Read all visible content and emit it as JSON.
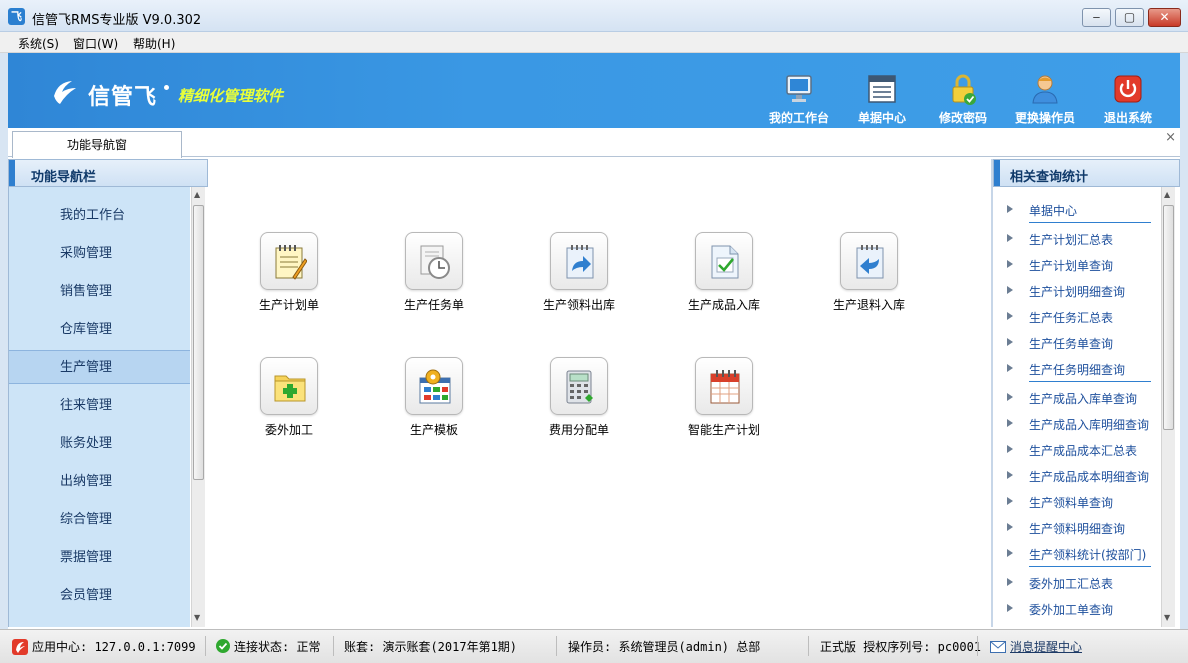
{
  "window": {
    "title": "信管飞RMS专业版 V9.0.302",
    "logo_glyph": "飞",
    "minimize": "‒",
    "restore": "▢",
    "close": "✕"
  },
  "menu": [
    "系统(S)",
    "窗口(W)",
    "帮助(H)"
  ],
  "banner": {
    "brand": "信管飞",
    "slogan": "精细化管理软件",
    "accent_color": "#e8ff3a",
    "tools": [
      {
        "label": "我的工作台",
        "icon": "monitor-icon"
      },
      {
        "label": "单据中心",
        "icon": "document-list-icon"
      },
      {
        "label": "修改密码",
        "icon": "lock-icon"
      },
      {
        "label": "更换操作员",
        "icon": "user-icon"
      },
      {
        "label": "退出系统",
        "icon": "power-icon"
      }
    ]
  },
  "tabs": {
    "active": "功能导航窗",
    "close_glyph": "×"
  },
  "left_panel": {
    "title": "功能导航栏",
    "items": [
      "我的工作台",
      "采购管理",
      "销售管理",
      "仓库管理",
      "生产管理",
      "往来管理",
      "账务处理",
      "出纳管理",
      "综合管理",
      "票据管理",
      "会员管理"
    ],
    "active_index": 4
  },
  "main": {
    "functions": [
      {
        "label": "生产计划单",
        "icon": "notepad-icon"
      },
      {
        "label": "生产任务单",
        "icon": "clock-document-icon"
      },
      {
        "label": "生产领料出库",
        "icon": "document-out-icon"
      },
      {
        "label": "生产成品入库",
        "icon": "document-check-icon"
      },
      {
        "label": "生产退料入库",
        "icon": "document-return-icon"
      },
      {
        "label": "委外加工",
        "icon": "folder-add-icon"
      },
      {
        "label": "生产模板",
        "icon": "template-gear-icon"
      },
      {
        "label": "费用分配单",
        "icon": "calculator-icon"
      },
      {
        "label": "智能生产计划",
        "icon": "calendar-icon"
      }
    ]
  },
  "right_panel": {
    "title": "相关查询统计",
    "items": [
      {
        "label": "单据中心",
        "sep": true
      },
      {
        "label": "生产计划汇总表",
        "sep": false
      },
      {
        "label": "生产计划单查询",
        "sep": false
      },
      {
        "label": "生产计划明细查询",
        "sep": false
      },
      {
        "label": "生产任务汇总表",
        "sep": false
      },
      {
        "label": "生产任务单查询",
        "sep": false
      },
      {
        "label": "生产任务明细查询",
        "sep": true
      },
      {
        "label": "生产成品入库单查询",
        "sep": false
      },
      {
        "label": "生产成品入库明细查询",
        "sep": false
      },
      {
        "label": "生产成品成本汇总表",
        "sep": false
      },
      {
        "label": "生产成品成本明细查询",
        "sep": false
      },
      {
        "label": "生产领料单查询",
        "sep": false
      },
      {
        "label": "生产领料明细查询",
        "sep": false
      },
      {
        "label": "生产领料统计(按部门)",
        "sep": true
      },
      {
        "label": "委外加工汇总表",
        "sep": false
      },
      {
        "label": "委外加工单查询",
        "sep": false
      }
    ]
  },
  "status": {
    "app_center": "应用中心: 127.0.0.1:7099",
    "connection": "连接状态: 正常",
    "account": "账套: 演示账套(2017年第1期)",
    "operator": "操作员: 系统管理员(admin) 总部",
    "license": "正式版 授权序列号: pc0001",
    "messages": "消息提醒中心"
  }
}
